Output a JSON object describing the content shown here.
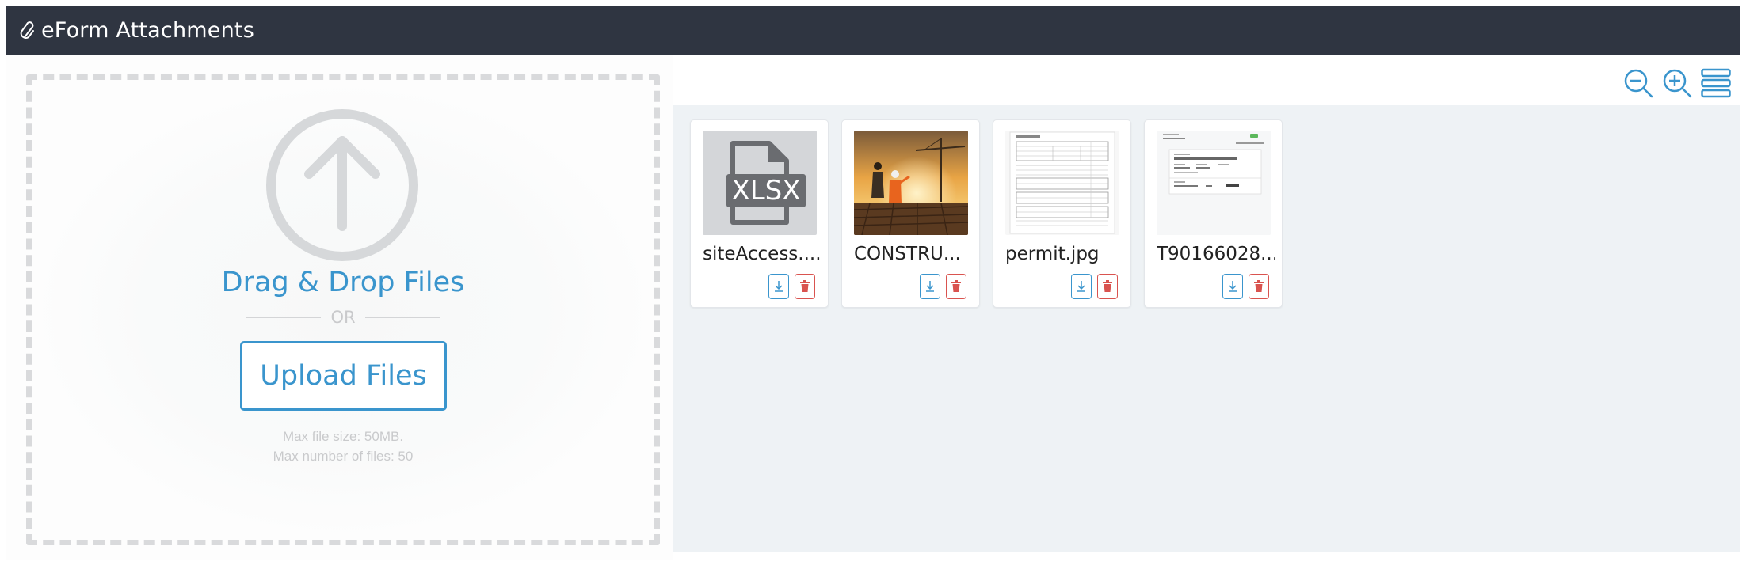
{
  "header": {
    "title": "eForm Attachments",
    "icon": "paperclip-icon"
  },
  "dropzone": {
    "title": "Drag & Drop Files",
    "or_text": "OR",
    "upload_label": "Upload Files",
    "max_size": "Max file size: 50MB.",
    "max_files": "Max number of files: 50"
  },
  "toolbar": {
    "zoom_out": "zoom-out-icon",
    "zoom_in": "zoom-in-icon",
    "list_view": "list-view-icon"
  },
  "files": [
    {
      "name": "siteAccess....",
      "type": "XLSX"
    },
    {
      "name": "CONSTRU...",
      "type": "image"
    },
    {
      "name": "permit.jpg",
      "type": "image"
    },
    {
      "name": "T90166028...",
      "type": "image"
    }
  ],
  "colors": {
    "accent": "#3a95cd",
    "danger": "#d9534f",
    "header_bg": "#2f3541",
    "gallery_bg": "#eef2f5"
  }
}
